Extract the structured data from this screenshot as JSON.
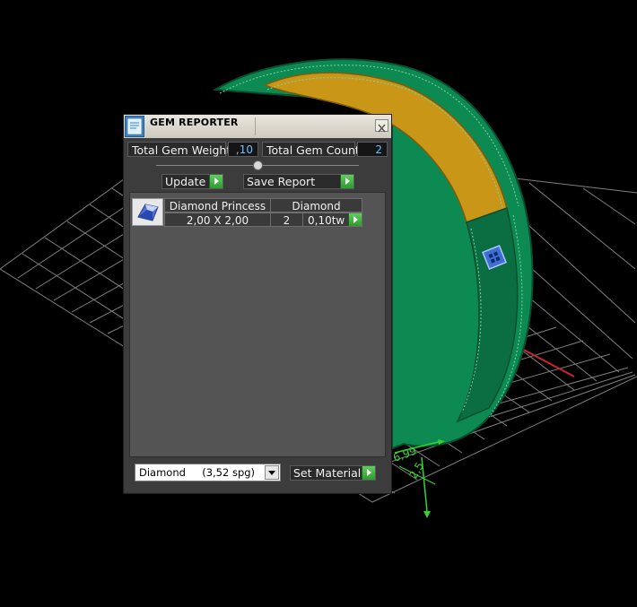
{
  "window": {
    "title": "GEM REPORTER"
  },
  "totals": {
    "weight_label": "Total Gem Weight",
    "weight_value": ",10",
    "count_label": "Total Gem Count",
    "count_value": "2"
  },
  "buttons": {
    "update": "Update",
    "save_report": "Save Report",
    "set_material": "Set Material"
  },
  "gems": [
    {
      "name": "Diamond Princess",
      "material": "Diamond",
      "size": "2,00 X 2,00",
      "count": "2",
      "weight": "0,10tw"
    }
  ],
  "material_select": {
    "value": "Diamond     (3,52 spg)"
  },
  "viewport": {
    "dimension_labels": [
      "6,99",
      "2,5"
    ],
    "colors": {
      "ring_body": "#0d8a52",
      "ring_interior": "#c99618",
      "gem": "#3f6fd1",
      "grid": "#7f7f7f",
      "axis_x": "#c8282a",
      "axis_y": "#1d8fc4",
      "dimension": "#34d233"
    }
  },
  "colors": {
    "window_bg": "#3c3c3c",
    "panel_bg": "#545454",
    "value_text": "#6fc1ff",
    "accent_green": "#3ab03a"
  },
  "icons": {
    "title": "gem-reporter-icon",
    "close": "close-icon",
    "arrow": "play-arrow-icon",
    "dropdown": "chevron-down-icon",
    "gem": "gem-thumbnail-icon"
  }
}
